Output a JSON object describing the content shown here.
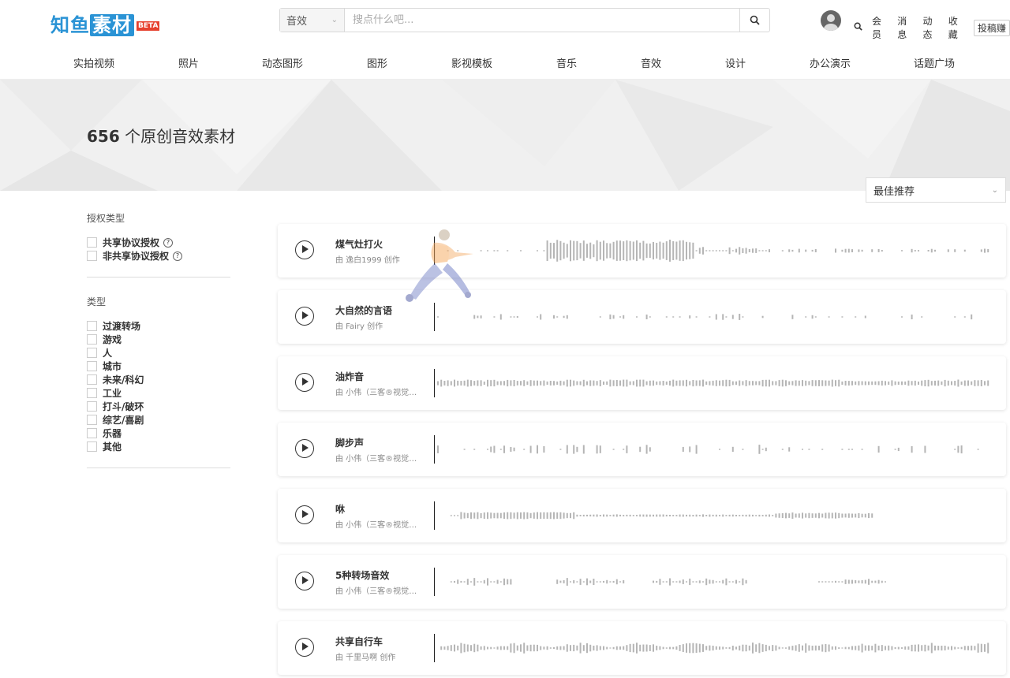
{
  "header": {
    "logo_text_a": "知鱼",
    "logo_text_b": "素材",
    "logo_badge": "BETA",
    "search_category": "音效",
    "search_placeholder": "搜点什么吧...",
    "user_links": [
      "会员",
      "消息",
      "动态",
      "收藏"
    ],
    "contribute_label": "投稿赚"
  },
  "nav": [
    "实拍视频",
    "照片",
    "动态图形",
    "图形",
    "影视模板",
    "音乐",
    "音效",
    "设计",
    "办公演示",
    "话题广场"
  ],
  "banner": {
    "count": "656",
    "suffix": "个原创音效素材"
  },
  "sort": {
    "selected": "最佳推荐"
  },
  "filters": {
    "license_heading": "授权类型",
    "license_options": [
      "共享协议授权",
      "非共享协议授权"
    ],
    "type_heading": "类型",
    "type_options": [
      "过渡转场",
      "游戏",
      "人",
      "城市",
      "未来/科幻",
      "工业",
      "打斗/破环",
      "综艺/喜剧",
      "乐器",
      "其他"
    ]
  },
  "sounds": [
    {
      "title": "煤气灶打火",
      "author": "由 逸白1999 创作"
    },
    {
      "title": "大自然的言语",
      "author": "由 Fairy 创作"
    },
    {
      "title": "油炸音",
      "author": "由 小伟（三客®视觉工作室）创作"
    },
    {
      "title": "脚步声",
      "author": "由 小伟（三客®视觉工作室）创作"
    },
    {
      "title": "咻",
      "author": "由 小伟（三客®视觉工作室）创作"
    },
    {
      "title": "5种转场音效",
      "author": "由 小伟（三客®视觉工作室）创作"
    },
    {
      "title": "共享自行车",
      "author": "由 千里马啊 创作"
    }
  ],
  "colors": {
    "brand": "#2a93d5",
    "badge": "#e6412f",
    "waveform": "#b5b5b5"
  }
}
